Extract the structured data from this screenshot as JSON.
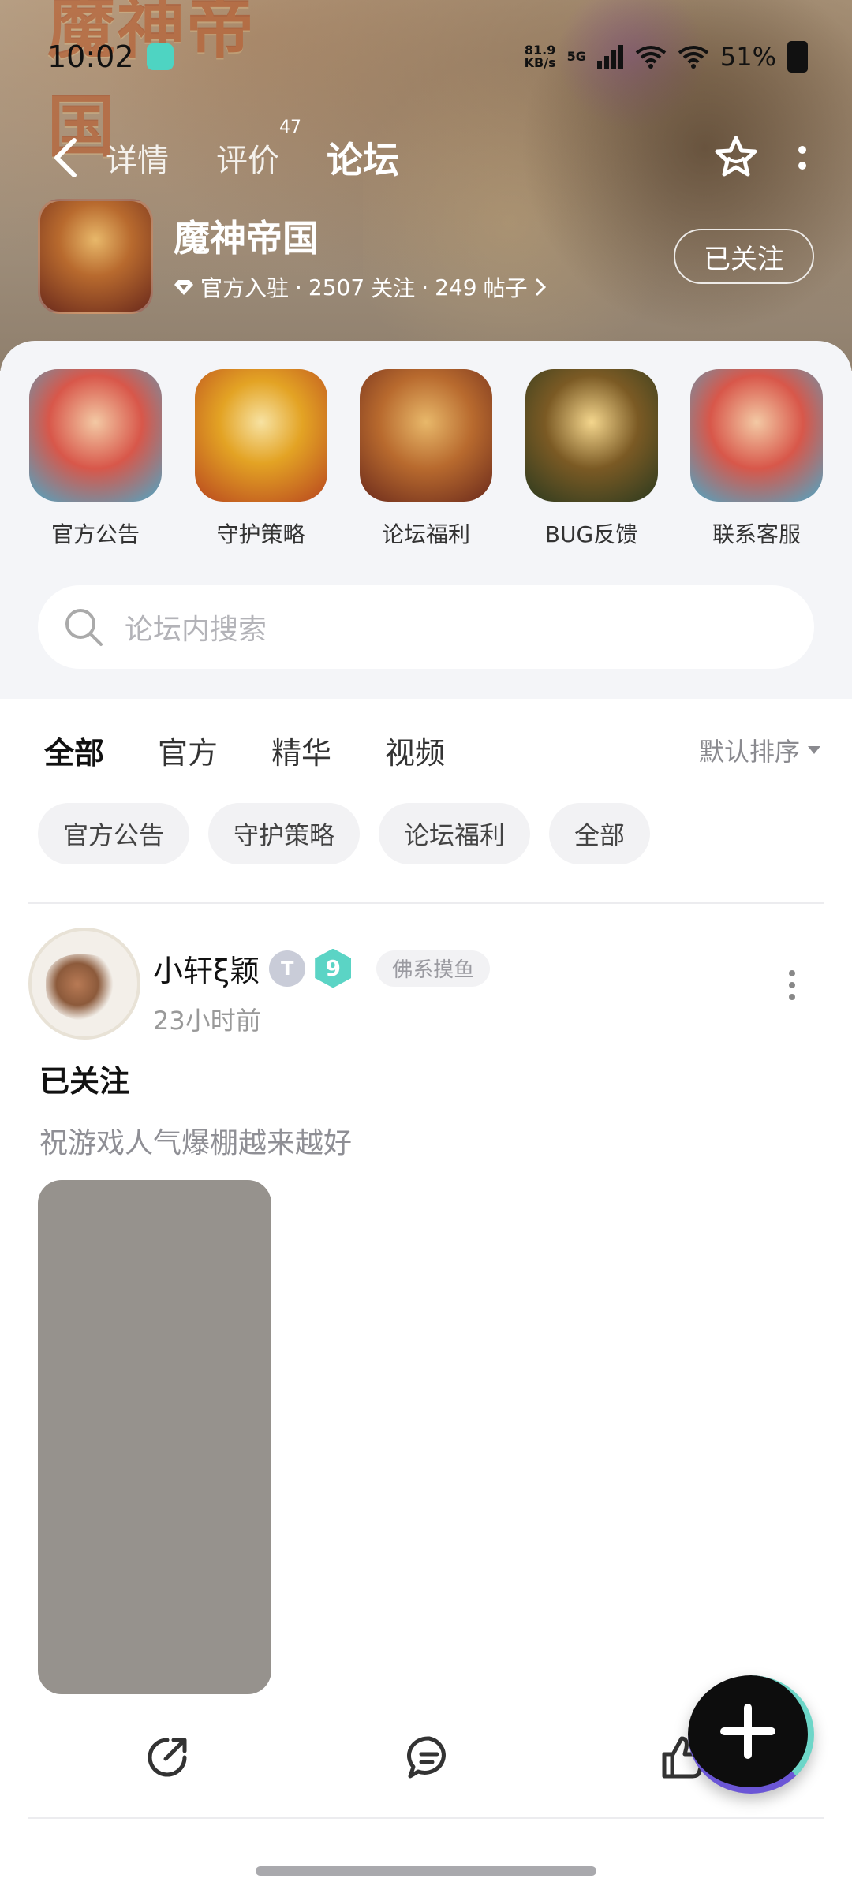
{
  "status_bar": {
    "time": "10:02",
    "net_speed_value": "81.9",
    "net_speed_unit": "KB/s",
    "network": "5G",
    "battery": "51%"
  },
  "hero": {
    "logo_text": "魔神帝国"
  },
  "nav": {
    "tabs": [
      {
        "label": "详情"
      },
      {
        "label": "评价",
        "badge": "47"
      },
      {
        "label": "论坛"
      }
    ],
    "active_tab": "论坛"
  },
  "game": {
    "name": "魔神帝国",
    "official": "官方入驻",
    "followers": "2507",
    "followers_label": "关注",
    "posts": "249",
    "posts_label": "帖子",
    "follow_button": "已关注"
  },
  "categories": [
    {
      "label": "官方公告"
    },
    {
      "label": "守护策略"
    },
    {
      "label": "论坛福利"
    },
    {
      "label": "BUG反馈"
    },
    {
      "label": "联系客服"
    }
  ],
  "search": {
    "placeholder": "论坛内搜索"
  },
  "filters": {
    "tabs": [
      "全部",
      "官方",
      "精华",
      "视频"
    ],
    "active": "全部",
    "sort": "默认排序"
  },
  "chips": [
    "官方公告",
    "守护策略",
    "论坛福利",
    "全部"
  ],
  "post": {
    "author": "小轩ξ颖",
    "badge_level": "9",
    "badge_letter": "T",
    "tag": "佛系摸鱼",
    "time": "23小时前",
    "title": "已关注",
    "body": "祝游戏人气爆棚越来越好"
  },
  "colors": {
    "accent": "#34d1c1",
    "fab": "#0d0d0d"
  }
}
